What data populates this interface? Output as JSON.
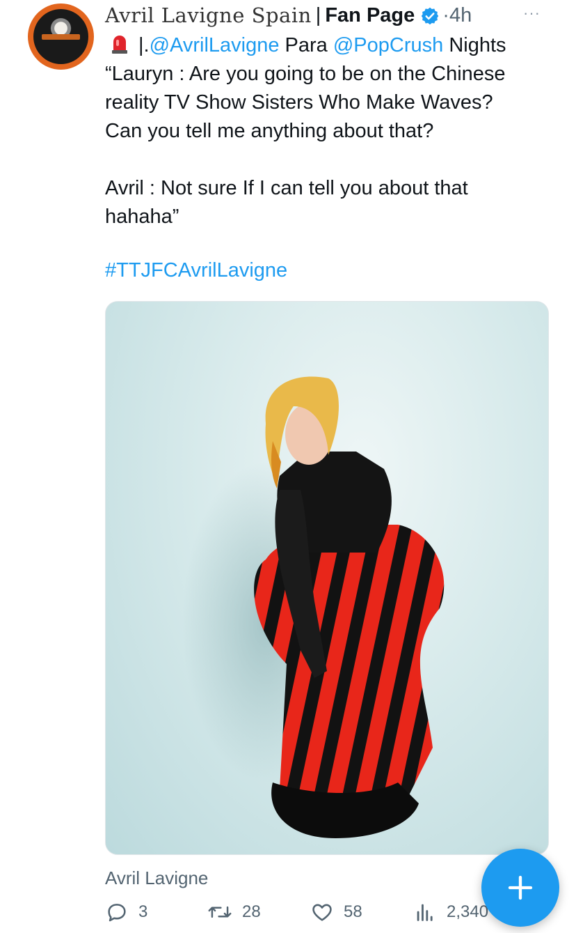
{
  "tweet": {
    "author_script": "Avril Lavigne Spain",
    "author_separator": "|",
    "author_bold": "Fan Page",
    "dot": "·",
    "time": "4h",
    "more": "···",
    "line1_prefix": "|.",
    "mention1": "@AvrilLavigne",
    "line1_mid": " Para ",
    "mention2": "@PopCrush",
    "line1_suffix": " Nights",
    "body": "“Lauryn : Are you going to be on the Chinese\nreality TV Show Sisters Who Make Waves?\nCan you tell me anything about that?\n\nAvril : Not sure If I can tell you about that\nhahaha”",
    "hashtag": "#TTJFCAvrilLavigne",
    "source_label": "Avril Lavigne"
  },
  "actions": {
    "replies": "3",
    "retweets": "28",
    "likes": "58",
    "views": "2,340"
  },
  "colors": {
    "accent": "#1d9bf0",
    "muted": "#536471",
    "avatar_ring": "#e2651e"
  },
  "icons": [
    "verified-badge-icon",
    "siren-icon",
    "reply-icon",
    "retweet-icon",
    "like-icon",
    "views-icon",
    "plus-icon"
  ]
}
